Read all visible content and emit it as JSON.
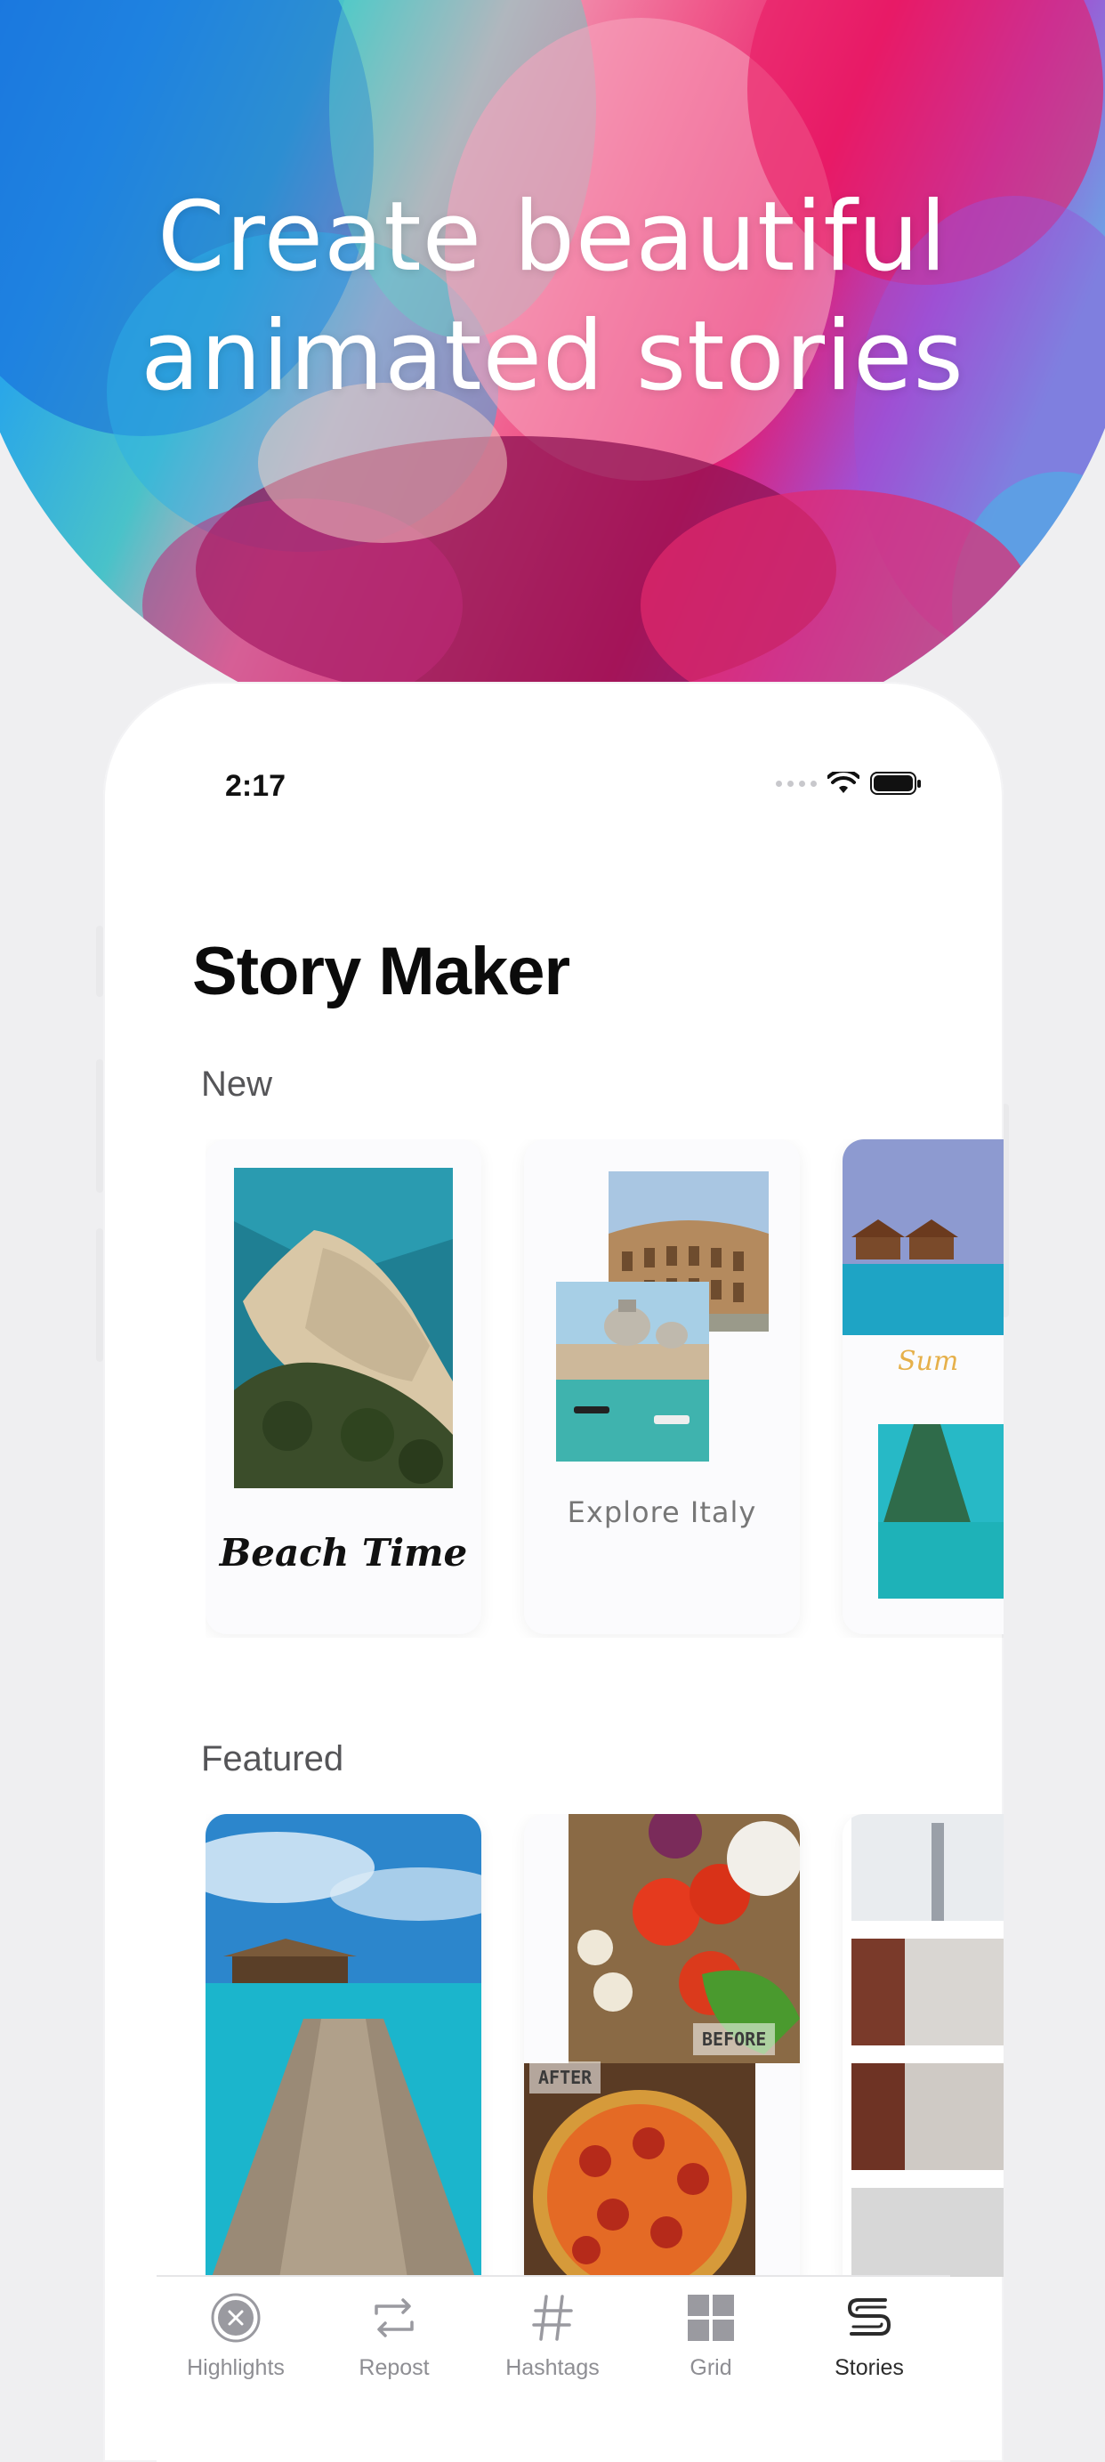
{
  "headline": {
    "line1": "Create beautiful",
    "line2": "animated stories"
  },
  "status": {
    "time": "2:17"
  },
  "app": {
    "title": "Story Maker"
  },
  "sections": {
    "new": "New",
    "featured": "Featured"
  },
  "new_cards": [
    {
      "caption": "Beach Time"
    },
    {
      "caption": "Explore Italy"
    },
    {
      "caption": "Sum"
    }
  ],
  "featured_cards": [
    {
      "stamp_before": "BEFORE",
      "stamp_after": "AFTER"
    }
  ],
  "tabs": [
    {
      "label": "Highlights",
      "icon": "highlights-icon"
    },
    {
      "label": "Repost",
      "icon": "repost-icon"
    },
    {
      "label": "Hashtags",
      "icon": "hashtag-icon"
    },
    {
      "label": "Grid",
      "icon": "grid-icon"
    },
    {
      "label": "Stories",
      "icon": "stories-icon"
    }
  ],
  "active_tab": "Stories",
  "colors": {
    "accent": "#2b2b2b",
    "inactive": "#8e8e93",
    "sand_caption": "#e6b04a"
  }
}
